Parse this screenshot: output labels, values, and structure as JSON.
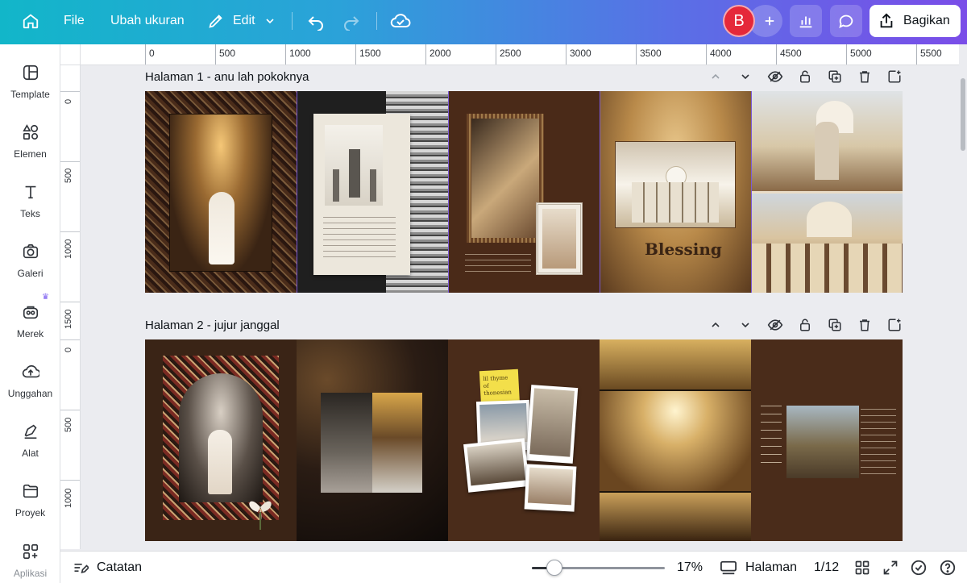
{
  "topbar": {
    "file_label": "File",
    "resize_label": "Ubah ukuran",
    "edit_label": "Edit",
    "avatar_initial": "B",
    "share_label": "Bagikan"
  },
  "sidebar": {
    "items": [
      {
        "label": "Template"
      },
      {
        "label": "Elemen"
      },
      {
        "label": "Teks"
      },
      {
        "label": "Galeri"
      },
      {
        "label": "Merek"
      },
      {
        "label": "Unggahan"
      },
      {
        "label": "Alat"
      },
      {
        "label": "Proyek"
      },
      {
        "label": "Aplikasi"
      }
    ]
  },
  "ruler_top": [
    "0",
    "500",
    "1000",
    "1500",
    "2000",
    "2500",
    "3000",
    "3500",
    "4000",
    "4500",
    "5000",
    "5500"
  ],
  "ruler_left": [
    "0",
    "500",
    "1000",
    "1500",
    "0",
    "500",
    "1000"
  ],
  "pages": [
    {
      "title": "Halaman 1 - anu lah pokoknya"
    },
    {
      "title": "Halaman 2 - jujur janggal"
    }
  ],
  "page1_overlays": {
    "blessing": "Blessing"
  },
  "page2_overlays": {
    "sticky_note": "lil thyme of thonesian"
  },
  "bottombar": {
    "notes_label": "Catatan",
    "zoom_label": "17%",
    "zoom_fraction": 0.17,
    "pages_label": "Halaman",
    "page_count": "1/12"
  }
}
